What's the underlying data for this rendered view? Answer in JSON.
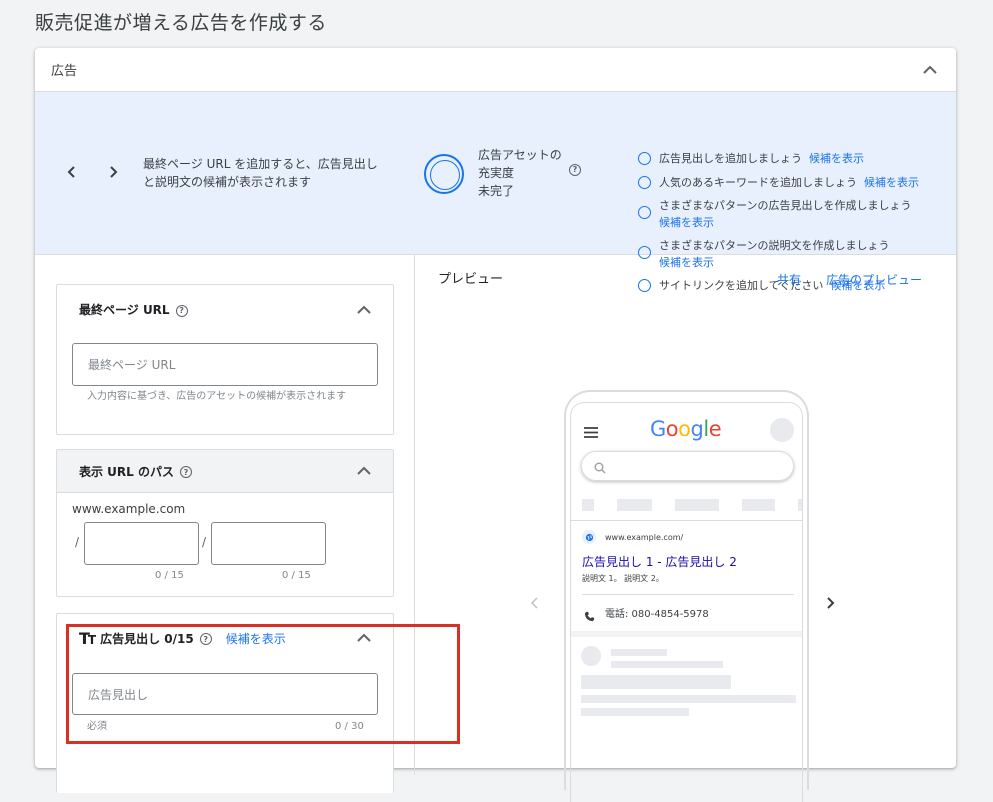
{
  "page_title": "販売促進が増える広告を作成する",
  "card": {
    "title": "広告"
  },
  "banner": {
    "message": "最終ページ URL を追加すると、広告見出しと説明文の候補が表示されます",
    "strength_label": "広告アセットの充実度",
    "strength_status": "未完了",
    "tasks": [
      {
        "text": "広告見出しを追加しましょう",
        "link": "候補を表示"
      },
      {
        "text": "人気のあるキーワードを追加しましょう",
        "link": "候補を表示"
      },
      {
        "text": "さまざまなパターンの広告見出しを作成しましょう",
        "link": "候補を表示"
      },
      {
        "text": "さまざまなパターンの説明文を作成しましょう",
        "link": "候補を表示"
      },
      {
        "text": "サイトリンクを追加してください",
        "link": "候補を表示"
      }
    ]
  },
  "final_url": {
    "title": "最終ページ URL",
    "placeholder": "最終ページ URL",
    "hint": "入力内容に基づき、広告のアセットの候補が表示されます"
  },
  "display_path": {
    "title": "表示 URL のパス",
    "domain": "www.example.com",
    "separator": "/",
    "path1_count": "0 / 15",
    "path2_count": "0 / 15"
  },
  "headline": {
    "title": "広告見出し 0/15",
    "suggest_link": "候補を表示",
    "placeholder": "広告見出し",
    "required": "必須",
    "count": "0 / 30"
  },
  "preview": {
    "title": "プレビュー",
    "share": "共有",
    "ad_preview": "広告のプレビュー",
    "ad": {
      "url": "www.example.com/",
      "headline": "広告見出し 1 - 広告見出し 2",
      "description": "説明文 1。 説明文 2。",
      "phone": "電話: 080-4854-5978"
    },
    "logo_letters": [
      "G",
      "o",
      "o",
      "g",
      "l",
      "e"
    ],
    "logo_colors": [
      "#4285f4",
      "#ea4335",
      "#fbbc05",
      "#4285f4",
      "#34a853",
      "#ea4335"
    ]
  }
}
